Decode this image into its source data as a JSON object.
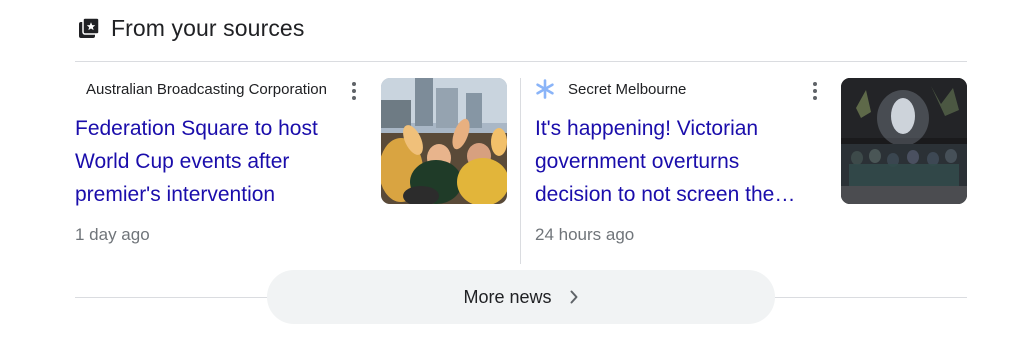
{
  "section": {
    "title": "From your sources",
    "icon": "news-sources-icon"
  },
  "articles": [
    {
      "source": "Australian Broadcasting Corporation",
      "source_icon": "none",
      "headline": "Federation Square to host World Cup events after premier's intervention",
      "time": "1 day ago",
      "thumbnail": "crowd-cheering-photo"
    },
    {
      "source": "Secret Melbourne",
      "source_icon": "asterisk-logo-icon",
      "headline": "It's happening! Victorian government overturns decision to not screen the…",
      "time": "24 hours ago",
      "thumbnail": "night-crowd-photo"
    }
  ],
  "more_news": {
    "label": "More news"
  },
  "colors": {
    "link": "#1a0dab",
    "secondary_text": "#70757a",
    "divider": "#dadce0",
    "button_bg": "#f1f3f4",
    "logo_blue": "#8ab4f8"
  }
}
